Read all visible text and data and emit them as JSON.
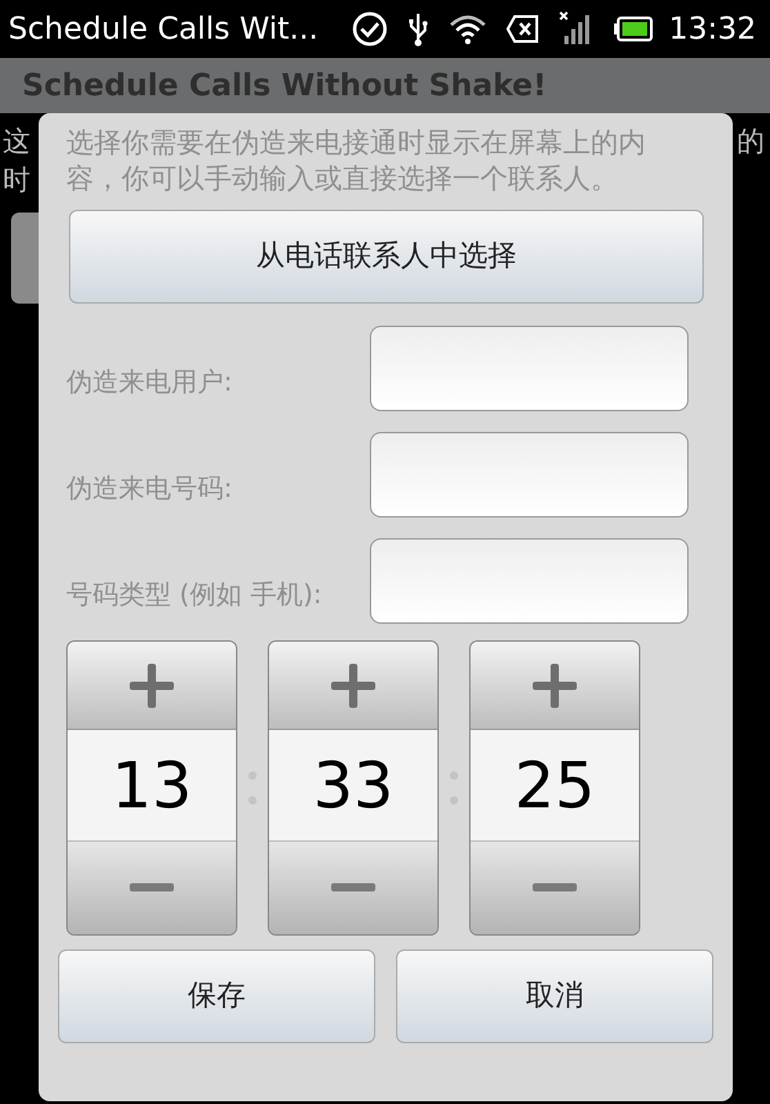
{
  "status_bar": {
    "app_title": "Schedule Calls Wit...",
    "time": "13:32"
  },
  "title_bar": {
    "title": "Schedule Calls Without Shake!"
  },
  "background": {
    "left_lines": [
      "这",
      "时"
    ],
    "right_text": "的"
  },
  "dialog": {
    "intro": "选择你需要在伪造来电接通时显示在屏幕上的内容，你可以手动输入或直接选择一个联系人。",
    "contact_button": "从电话联系人中选择",
    "fields": [
      {
        "label": "伪造来电用户:"
      },
      {
        "label": "伪造来电号码:"
      },
      {
        "label": "号码类型 (例如 手机):"
      }
    ],
    "time_picker": [
      {
        "value": "13"
      },
      {
        "value": "33"
      },
      {
        "value": "25"
      }
    ],
    "buttons": [
      "保存",
      "取消"
    ]
  }
}
